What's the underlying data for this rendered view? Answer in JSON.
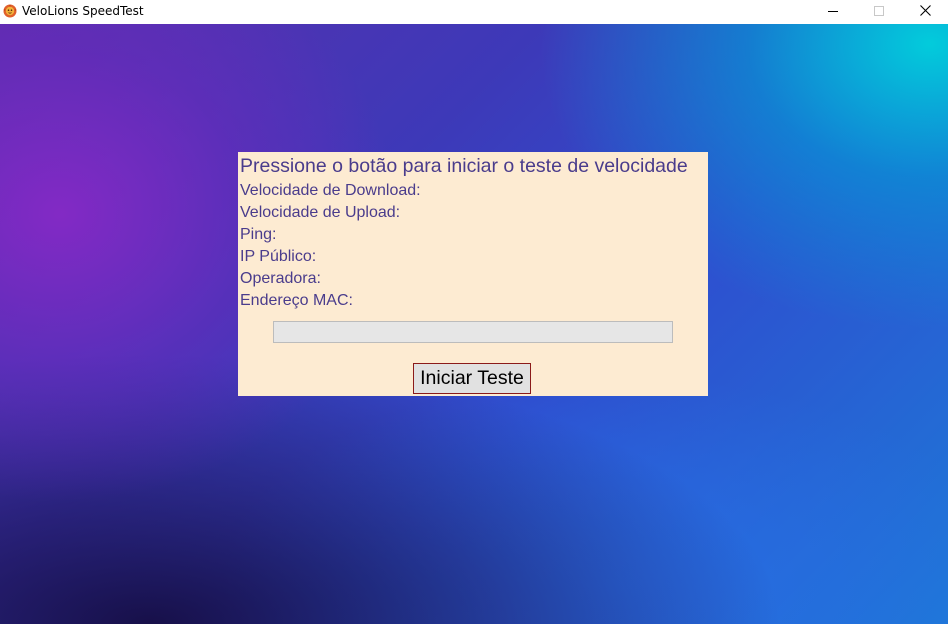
{
  "window": {
    "title": "VeloLions SpeedTest",
    "app_icon": "lion-logo-icon",
    "controls": {
      "minimize_icon": "minimize-icon",
      "maximize_icon": "maximize-icon",
      "close_icon": "close-icon"
    }
  },
  "panel": {
    "heading": "Pressione o botão para iniciar o teste de velocidade",
    "download_label": "Velocidade de Download:",
    "upload_label": "Velocidade de Upload:",
    "ping_label": "Ping:",
    "public_ip_label": "IP Público:",
    "carrier_label": "Operadora:",
    "mac_label": "Endereço MAC:",
    "progress_value": 0,
    "start_button_label": "Iniciar Teste"
  },
  "colors": {
    "panel_background": "#fdebd2",
    "text": "#4a3c8c",
    "button_border": "#8b1a1a"
  }
}
